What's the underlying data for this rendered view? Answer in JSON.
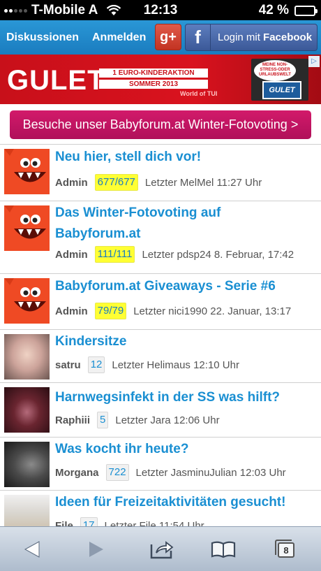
{
  "status_bar": {
    "carrier": "T-Mobile A",
    "time": "12:13",
    "battery_percent": "42 %",
    "battery_level": 0.42
  },
  "nav": {
    "diskussionen": "Diskussionen",
    "anmelden": "Anmelden",
    "gplus_label": "g+",
    "facebook_prefix": "Login mit ",
    "facebook_brand": "Facebook"
  },
  "ad": {
    "logo": "GULET",
    "line1": "1 EURO-KINDERAKTION",
    "line2": "SOMMER 2013",
    "world": "World of TUI",
    "badge_text": "MEINE NON-STRESS-ODER URLAUBSWELT",
    "badge_logo": "GULET",
    "choice_icon": "adchoices-icon"
  },
  "cta": {
    "label": "Besuche unser Babyforum.at Winter-Fotovoting >"
  },
  "threads": [
    {
      "title": "Neu hier, stell dich vor!",
      "author": "Admin",
      "count": "677/677",
      "highlight": true,
      "last": "Letzter MelMel 11:27 Uhr",
      "avatar": "monster"
    },
    {
      "title": "Das Winter-Fotovoting auf Babyforum.at",
      "author": "Admin",
      "count": "111/111",
      "highlight": true,
      "last": "Letzter pdsp24 8. Februar, 17:42",
      "avatar": "monster"
    },
    {
      "title": "Babyforum.at Giveaways - Serie #6",
      "author": "Admin",
      "count": "79/79",
      "highlight": true,
      "last": "Letzter nici1990 22. Januar, 13:17",
      "avatar": "monster"
    },
    {
      "title": "Kindersitze",
      "author": "satru",
      "count": "12",
      "highlight": false,
      "last": "Letzter Helimaus 12:10 Uhr",
      "avatar": "photo"
    },
    {
      "title": "Harnwegsinfekt in der SS was hilft?",
      "author": "Raphiii",
      "count": "5",
      "highlight": false,
      "last": "Letzter Jara 12:06 Uhr",
      "avatar": "photo"
    },
    {
      "title": "Was kocht ihr heute?",
      "author": "Morgana",
      "count": "722",
      "highlight": false,
      "last": "Letzter JasminuJulian 12:03 Uhr",
      "avatar": "photo"
    },
    {
      "title": "Ideen für Freizeitaktivitäten gesucht!",
      "author": "File",
      "count": "17",
      "highlight": false,
      "last": "Letzter File 11:54 Uhr",
      "avatar": "photo"
    }
  ],
  "toolbar": {
    "tabs_count": "8",
    "icons": [
      "back-arrow-icon",
      "forward-arrow-icon",
      "share-icon",
      "bookmarks-icon",
      "tabs-icon"
    ]
  }
}
